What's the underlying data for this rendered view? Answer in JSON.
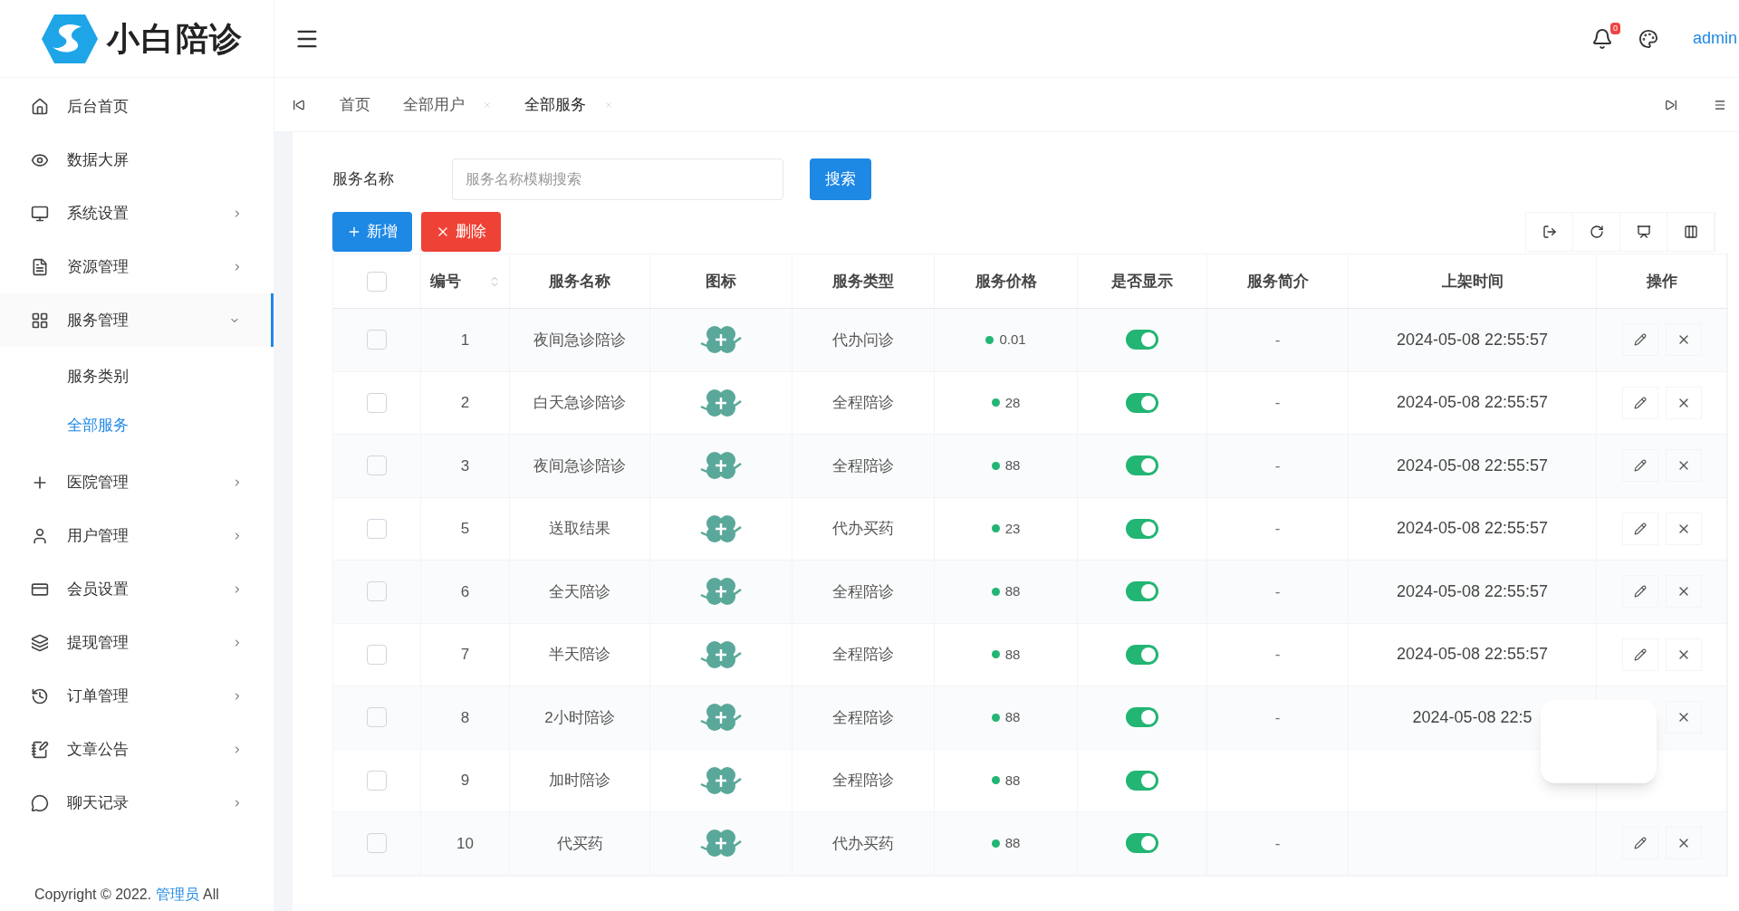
{
  "logo": {
    "title": "小白陪诊"
  },
  "header": {
    "notification_count": "0",
    "user": "admin"
  },
  "sidebar": {
    "items": [
      {
        "label": "后台首页",
        "expandable": false,
        "selected": false
      },
      {
        "label": "数据大屏",
        "expandable": false,
        "selected": false
      },
      {
        "label": "系统设置",
        "expandable": true,
        "expanded": false,
        "selected": false
      },
      {
        "label": "资源管理",
        "expandable": true,
        "expanded": false,
        "selected": false
      },
      {
        "label": "服务管理",
        "expandable": true,
        "expanded": true,
        "selected": true,
        "children": [
          {
            "label": "服务类别",
            "selected": false
          },
          {
            "label": "全部服务",
            "selected": true
          }
        ]
      },
      {
        "label": "医院管理",
        "expandable": true,
        "expanded": false,
        "selected": false
      },
      {
        "label": "用户管理",
        "expandable": true,
        "expanded": false,
        "selected": false
      },
      {
        "label": "会员设置",
        "expandable": true,
        "expanded": false,
        "selected": false
      },
      {
        "label": "提现管理",
        "expandable": true,
        "expanded": false,
        "selected": false
      },
      {
        "label": "订单管理",
        "expandable": true,
        "expanded": false,
        "selected": false
      },
      {
        "label": "文章公告",
        "expandable": true,
        "expanded": false,
        "selected": false
      },
      {
        "label": "聊天记录",
        "expandable": true,
        "expanded": false,
        "selected": false
      }
    ],
    "copyright": {
      "prefix": "Copyright © 2022.",
      "link": "管理员",
      "suffix": "All"
    }
  },
  "tabs": [
    {
      "label": "首页",
      "closable": false,
      "selected": false
    },
    {
      "label": "全部用户",
      "closable": true,
      "selected": false
    },
    {
      "label": "全部服务",
      "closable": true,
      "selected": true
    }
  ],
  "search": {
    "label": "服务名称",
    "placeholder": "服务名称模糊搜索",
    "button": "搜索"
  },
  "actions": {
    "add": "新增",
    "delete": "删除"
  },
  "table": {
    "all_checked": false,
    "columns": [
      "编号",
      "服务名称",
      "图标",
      "服务类型",
      "服务价格",
      "是否显示",
      "服务简介",
      "上架时间",
      "操作"
    ],
    "rows": [
      {
        "checked": false,
        "id": "1",
        "name": "夜间急诊陪诊",
        "type": "代办问诊",
        "price": "0.01",
        "shown": true,
        "intro": "-",
        "time": "2024-05-08 22:55:57",
        "edit": true,
        "remove": true
      },
      {
        "checked": false,
        "id": "2",
        "name": "白天急诊陪诊",
        "type": "全程陪诊",
        "price": "28",
        "shown": true,
        "intro": "-",
        "time": "2024-05-08 22:55:57",
        "edit": true,
        "remove": true
      },
      {
        "checked": false,
        "id": "3",
        "name": "夜间急诊陪诊",
        "type": "全程陪诊",
        "price": "88",
        "shown": true,
        "intro": "-",
        "time": "2024-05-08 22:55:57",
        "edit": true,
        "remove": true
      },
      {
        "checked": false,
        "id": "5",
        "name": "送取结果",
        "type": "代办买药",
        "price": "23",
        "shown": true,
        "intro": "-",
        "time": "2024-05-08 22:55:57",
        "edit": true,
        "remove": true
      },
      {
        "checked": false,
        "id": "6",
        "name": "全天陪诊",
        "type": "全程陪诊",
        "price": "88",
        "shown": true,
        "intro": "-",
        "time": "2024-05-08 22:55:57",
        "edit": true,
        "remove": true
      },
      {
        "checked": false,
        "id": "7",
        "name": "半天陪诊",
        "type": "全程陪诊",
        "price": "88",
        "shown": true,
        "intro": "-",
        "time": "2024-05-08 22:55:57",
        "edit": true,
        "remove": true
      },
      {
        "checked": false,
        "id": "8",
        "name": "2小时陪诊",
        "type": "全程陪诊",
        "price": "88",
        "shown": true,
        "intro": "-",
        "time": "2024-05-08 22:5",
        "edit": false,
        "remove": true
      },
      {
        "checked": false,
        "id": "9",
        "name": "加时陪诊",
        "type": "全程陪诊",
        "price": "88",
        "shown": true,
        "edit": false,
        "remove": false
      },
      {
        "checked": false,
        "id": "10",
        "name": "代买药",
        "type": "代办买药",
        "price": "88",
        "shown": true,
        "intro": "-",
        "edit": true,
        "remove": true
      }
    ]
  }
}
